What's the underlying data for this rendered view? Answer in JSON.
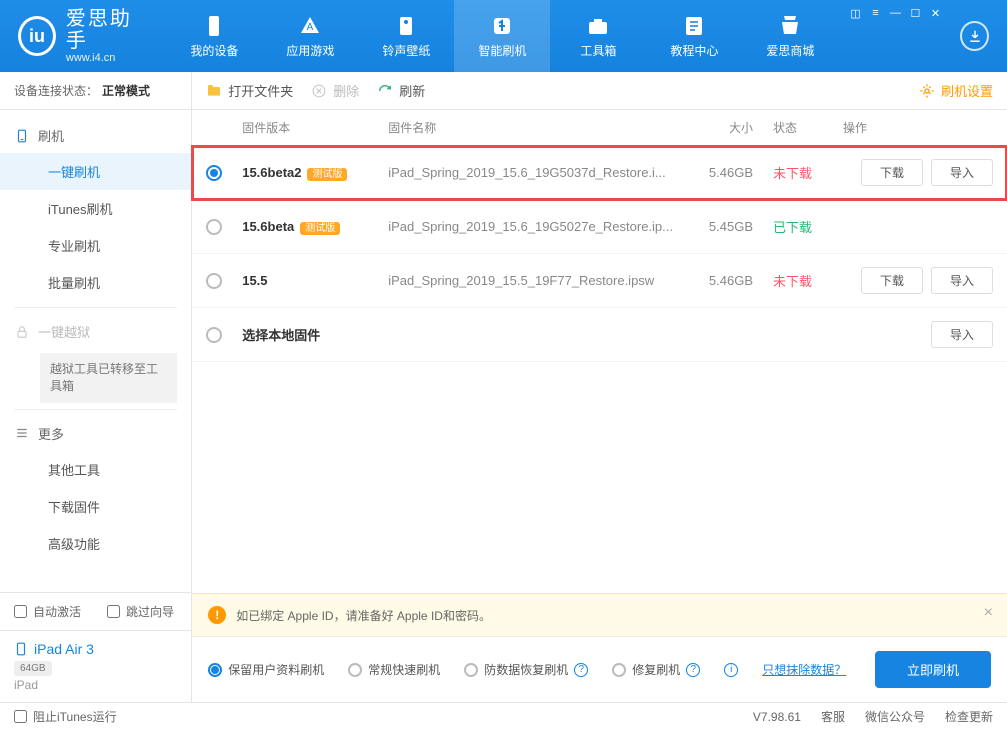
{
  "app": {
    "name_cn": "爱思助手",
    "name_en": "www.i4.cn"
  },
  "nav": {
    "items": [
      {
        "label": "我的设备"
      },
      {
        "label": "应用游戏"
      },
      {
        "label": "铃声壁纸"
      },
      {
        "label": "智能刷机"
      },
      {
        "label": "工具箱"
      },
      {
        "label": "教程中心"
      },
      {
        "label": "爱思商城"
      }
    ],
    "active_index": 3
  },
  "sidebar": {
    "status_label": "设备连接状态：",
    "status_value": "正常模式",
    "groups": {
      "flash": {
        "title": "刷机",
        "children": [
          "一键刷机",
          "iTunes刷机",
          "专业刷机",
          "批量刷机"
        ],
        "active_index": 0
      },
      "jailbreak": {
        "title": "一键越狱",
        "note": "越狱工具已转移至工具箱"
      },
      "more": {
        "title": "更多",
        "children": [
          "其他工具",
          "下载固件",
          "高级功能"
        ]
      }
    },
    "auto_activate": "自动激活",
    "skip_guide": "跳过向导",
    "device": {
      "name": "iPad Air 3",
      "storage": "64GB",
      "type": "iPad"
    }
  },
  "toolbar": {
    "open_folder": "打开文件夹",
    "delete": "删除",
    "refresh": "刷新",
    "settings": "刷机设置"
  },
  "table": {
    "columns": {
      "version": "固件版本",
      "name": "固件名称",
      "size": "大小",
      "status": "状态",
      "ops": "操作"
    },
    "rows": [
      {
        "version": "15.6beta2",
        "beta": "测试版",
        "name": "iPad_Spring_2019_15.6_19G5037d_Restore.i...",
        "size": "5.46GB",
        "status": "未下载",
        "status_kind": "red",
        "selected": true,
        "highlighted": true,
        "show_download": true,
        "show_import": true
      },
      {
        "version": "15.6beta",
        "beta": "测试版",
        "name": "iPad_Spring_2019_15.6_19G5027e_Restore.ip...",
        "size": "5.45GB",
        "status": "已下载",
        "status_kind": "green",
        "selected": false,
        "highlighted": false,
        "show_download": false,
        "show_import": false
      },
      {
        "version": "15.5",
        "beta": "",
        "name": "iPad_Spring_2019_15.5_19F77_Restore.ipsw",
        "size": "5.46GB",
        "status": "未下载",
        "status_kind": "red",
        "selected": false,
        "highlighted": false,
        "show_download": true,
        "show_import": true
      },
      {
        "version": "选择本地固件",
        "beta": "",
        "name": "",
        "size": "",
        "status": "",
        "status_kind": "",
        "selected": false,
        "highlighted": false,
        "show_download": false,
        "show_import": true
      }
    ],
    "download_label": "下载",
    "import_label": "导入"
  },
  "notice": {
    "text": "如已绑定 Apple ID，请准备好 Apple ID和密码。"
  },
  "options": {
    "items": [
      "保留用户资料刷机",
      "常规快速刷机",
      "防数据恢复刷机",
      "修复刷机"
    ],
    "selected_index": 0,
    "erase_link": "只想抹除数据？",
    "flash_now": "立即刷机"
  },
  "bottom": {
    "block_itunes": "阻止iTunes运行",
    "version": "V7.98.61",
    "service": "客服",
    "wechat": "微信公众号",
    "update": "检查更新"
  }
}
